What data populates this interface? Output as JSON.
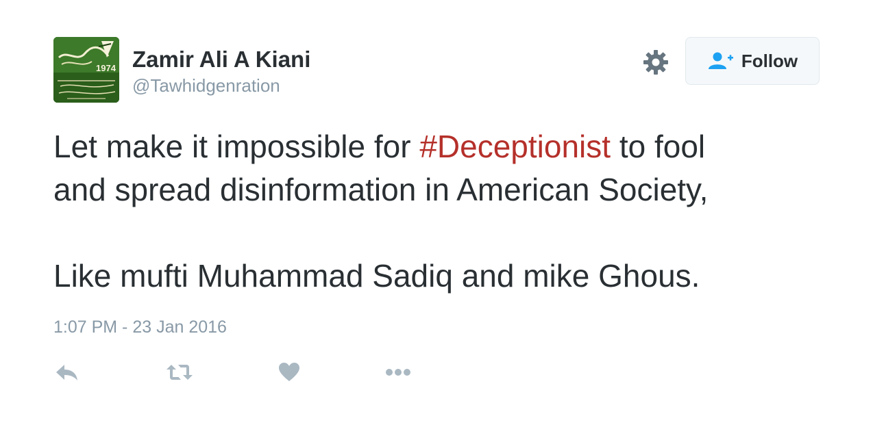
{
  "tweet": {
    "author": {
      "display_name": "Zamir Ali A Kiani",
      "screen_name": "@Tawhidgenration",
      "avatar": {
        "icon": "profile-avatar-image",
        "year_text": "1974",
        "colors": {
          "background": "#2e6b1f",
          "accent": "#f0eed8"
        }
      }
    },
    "header_actions": {
      "settings_icon": "gear-icon",
      "follow_label": "Follow",
      "follow_icon": "add-user-icon"
    },
    "text": {
      "line1_before": "Let make it impossible for ",
      "hashtag": "#Deceptionist",
      "line1_after": " to fool",
      "line2": "and spread disinformation in American Society,",
      "line3": "Like mufti Muhammad Sadiq and mike Ghous."
    },
    "timestamp": "1:07 PM - 23 Jan 2016",
    "actions": [
      {
        "name": "reply",
        "icon": "reply-icon"
      },
      {
        "name": "retweet",
        "icon": "retweet-icon"
      },
      {
        "name": "like",
        "icon": "heart-icon"
      },
      {
        "name": "more",
        "icon": "more-icon"
      }
    ],
    "colors": {
      "text": "#292f33",
      "secondary": "#8899a6",
      "hashtag": "#b5302a",
      "follow_accent": "#1da1f2",
      "action_icon": "#aab8c2"
    }
  }
}
